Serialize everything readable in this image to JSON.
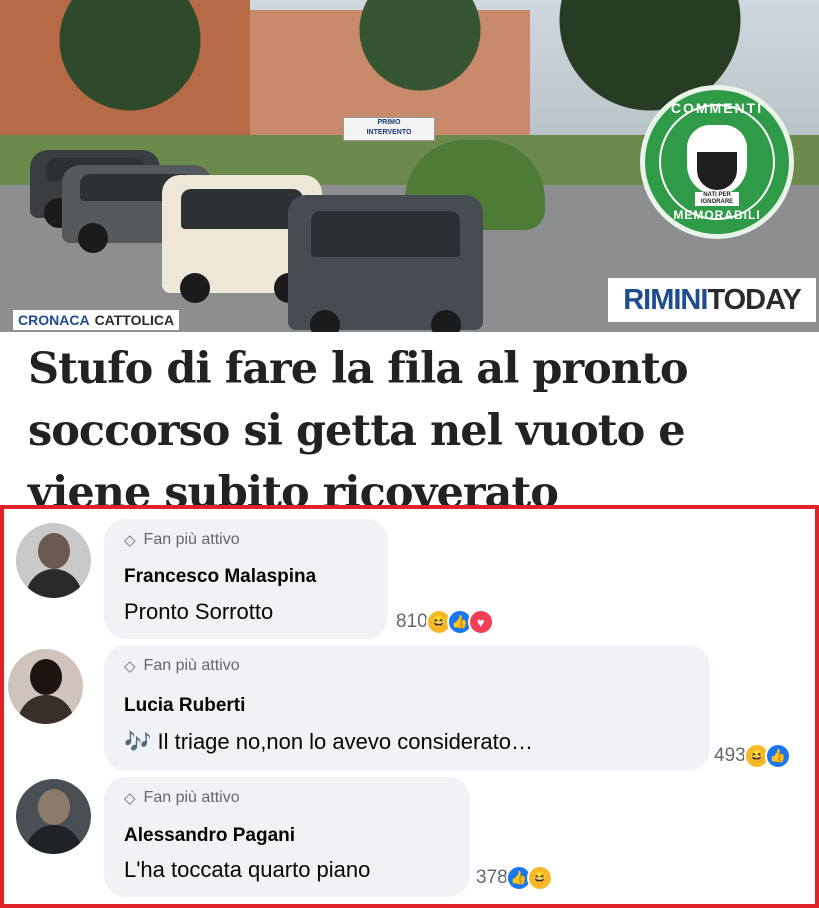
{
  "article": {
    "category_primary": "CRONACA",
    "category_secondary": "CATTOLICA",
    "headline": "Stufo di fare la fila al pronto soccorso si getta nel vuoto e viene subito ricoverato",
    "sign_line1": "PRIMO",
    "sign_line2": "INTERVENTO"
  },
  "logo": {
    "top_text": "COMMENTI",
    "bottom_text": "MEMORABILI",
    "tagline": "NATI PER IGNORARE"
  },
  "brand": {
    "part1": "RIMINI",
    "part2": "TODAY"
  },
  "comments": [
    {
      "badge": "Fan più attivo",
      "author": "Francesco Malaspina",
      "text": "Pronto Sorrotto",
      "count": "810",
      "reactions": [
        "haha",
        "like",
        "love"
      ]
    },
    {
      "badge": "Fan più attivo",
      "author": "Lucia Ruberti",
      "text": "🎶 Il triage no,non lo avevo considerato…",
      "count": "493",
      "reactions": [
        "haha",
        "like"
      ]
    },
    {
      "badge": "Fan più attivo",
      "author": "Alessandro Pagani",
      "text": "L'ha toccata quarto piano",
      "count": "378",
      "reactions": [
        "like",
        "haha"
      ]
    }
  ],
  "colors": {
    "frame": "#e0222b",
    "brand_blue": "#1d4d8f",
    "logo_green": "#2f9a48",
    "bubble": "#f0f2f5"
  }
}
